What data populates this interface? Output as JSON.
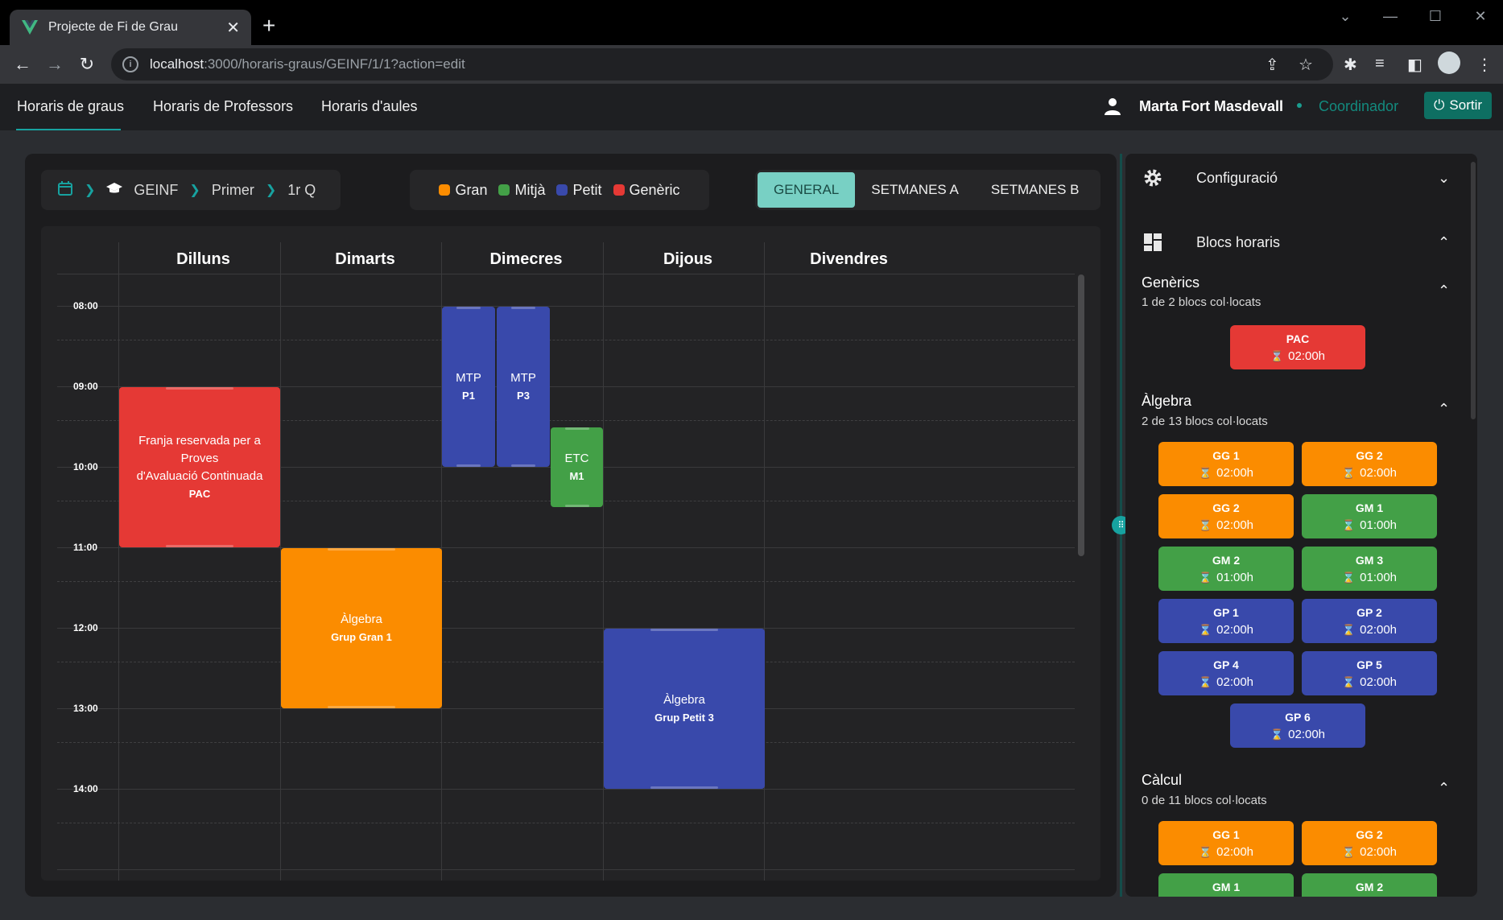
{
  "browser": {
    "tab_title": "Projecte de Fi de Grau",
    "url_host": "localhost",
    "url_rest": ":3000/horaris-graus/GEINF/1/1?action=edit"
  },
  "nav": {
    "tabs": [
      "Horaris de graus",
      "Horaris de Professors",
      "Horaris d'aules"
    ],
    "user_name": "Marta Fort Masdevall",
    "role": "Coordinador",
    "logout": "Sortir"
  },
  "breadcrumb": {
    "items": [
      "GEINF",
      "Primer",
      "1r Q"
    ]
  },
  "legend": [
    {
      "label": "Gran",
      "color": "#fb8c00"
    },
    {
      "label": "Mitjà",
      "color": "#43a047"
    },
    {
      "label": "Petit",
      "color": "#3949ab"
    },
    {
      "label": "Genèric",
      "color": "#e53935"
    }
  ],
  "view_tabs": [
    "GENERAL",
    "SETMANES A",
    "SETMANES B"
  ],
  "days": [
    "Dilluns",
    "Dimarts",
    "Dimecres",
    "Dijous",
    "Divendres"
  ],
  "times": [
    "08:00",
    "09:00",
    "10:00",
    "11:00",
    "12:00",
    "13:00",
    "14:00"
  ],
  "events": [
    {
      "line1": "Franja reservada per a Proves",
      "line2": "d'Avaluació Continuada",
      "bold": "PAC",
      "color": "red"
    },
    {
      "line1": "Àlgebra",
      "bold": "Grup Gran 1",
      "color": "orange"
    },
    {
      "line1": "MTP",
      "bold": "P1",
      "color": "blue"
    },
    {
      "line1": "MTP",
      "bold": "P3",
      "color": "blue"
    },
    {
      "line1": "ETC",
      "bold": "M1",
      "color": "green"
    },
    {
      "line1": "Àlgebra",
      "bold": "Grup Petit 3",
      "color": "blue"
    }
  ],
  "side": {
    "config_label": "Configuració",
    "blocs_label": "Blocs horaris",
    "groups": [
      {
        "title": "Genèrics",
        "subtitle": "1 de 2 blocs col·locats",
        "chips": [
          {
            "name": "PAC",
            "dur": "02:00h",
            "color": "red"
          }
        ]
      },
      {
        "title": "Àlgebra",
        "subtitle": "2 de 13 blocs col·locats",
        "chips": [
          {
            "name": "GG 1",
            "dur": "02:00h",
            "color": "orange"
          },
          {
            "name": "GG 2",
            "dur": "02:00h",
            "color": "orange"
          },
          {
            "name": "GG 2",
            "dur": "02:00h",
            "color": "orange"
          },
          {
            "name": "GM 1",
            "dur": "01:00h",
            "color": "green"
          },
          {
            "name": "GM 2",
            "dur": "01:00h",
            "color": "green"
          },
          {
            "name": "GM 3",
            "dur": "01:00h",
            "color": "green"
          },
          {
            "name": "GP 1",
            "dur": "02:00h",
            "color": "blue"
          },
          {
            "name": "GP 2",
            "dur": "02:00h",
            "color": "blue"
          },
          {
            "name": "GP 4",
            "dur": "02:00h",
            "color": "blue"
          },
          {
            "name": "GP 5",
            "dur": "02:00h",
            "color": "blue"
          },
          {
            "name": "GP 6",
            "dur": "02:00h",
            "color": "blue"
          }
        ]
      },
      {
        "title": "Càlcul",
        "subtitle": "0 de 11 blocs col·locats",
        "chips": [
          {
            "name": "GG 1",
            "dur": "02:00h",
            "color": "orange"
          },
          {
            "name": "GG 2",
            "dur": "02:00h",
            "color": "orange"
          },
          {
            "name": "GM 1",
            "dur": "",
            "color": "green"
          },
          {
            "name": "GM 2",
            "dur": "",
            "color": "green"
          }
        ]
      }
    ]
  },
  "colors": {
    "accent": "#17a2a0",
    "red": "#e53935",
    "orange": "#fb8c00",
    "blue": "#3949ab",
    "green": "#43a047"
  }
}
